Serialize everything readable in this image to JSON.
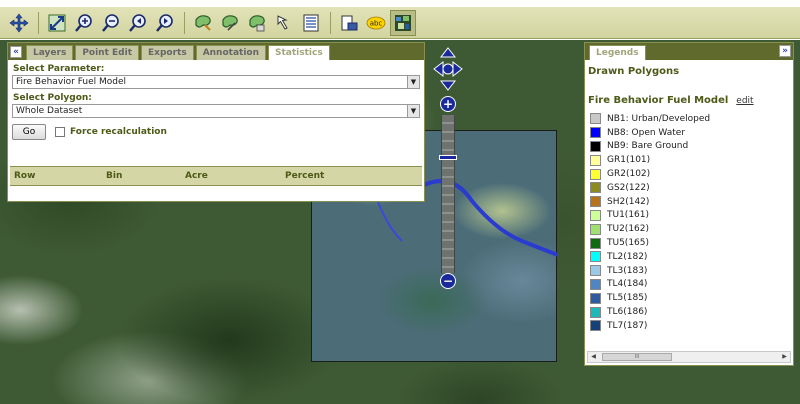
{
  "toolbar": {
    "tools": [
      {
        "icon": "pan-icon"
      },
      {
        "icon": "zoom-extent-icon"
      },
      {
        "icon": "zoom-in-icon"
      },
      {
        "icon": "zoom-out-icon"
      },
      {
        "icon": "previous-extent-icon"
      },
      {
        "icon": "next-extent-icon"
      },
      {
        "icon": "draw-polygon-icon"
      },
      {
        "icon": "edit-polygon-icon"
      },
      {
        "icon": "delete-polygon-icon"
      },
      {
        "icon": "select-arrow-icon"
      },
      {
        "icon": "attribute-table-icon"
      },
      {
        "icon": "print-map-icon"
      },
      {
        "icon": "label-abc-icon"
      },
      {
        "icon": "overlay-layer-icon"
      }
    ],
    "abc_text": "abc"
  },
  "panel": {
    "collapse_glyph": "«",
    "tabs": [
      "Layers",
      "Point Edit",
      "Exports",
      "Annotation",
      "Statistics"
    ],
    "active_tab": "Statistics",
    "parameter_label": "Select Parameter:",
    "parameter_value": "Fire Behavior Fuel Model",
    "polygon_label": "Select Polygon:",
    "polygon_value": "Whole Dataset",
    "go_label": "Go",
    "force_label": "Force recalculation",
    "columns": [
      "Row",
      "Bin",
      "Acre",
      "Percent"
    ]
  },
  "zoom": {
    "plus": "+",
    "minus": "−"
  },
  "legend": {
    "tab": "Legends",
    "expand_glyph": "»",
    "drawn_title": "Drawn Polygons",
    "model_title": "Fire Behavior Fuel Model",
    "edit_label": "edit",
    "items": [
      {
        "label": "NB1: Urban/Developed",
        "color": "#c8c8c8"
      },
      {
        "label": "NB8: Open Water",
        "color": "#0000ff"
      },
      {
        "label": "NB9: Bare Ground",
        "color": "#000000"
      },
      {
        "label": "GR1(101)",
        "color": "#ffff99"
      },
      {
        "label": "GR2(102)",
        "color": "#ffff33"
      },
      {
        "label": "GS2(122)",
        "color": "#8b8b1e"
      },
      {
        "label": "SH2(142)",
        "color": "#b87318"
      },
      {
        "label": "TU1(161)",
        "color": "#ccff99"
      },
      {
        "label": "TU2(162)",
        "color": "#a0e070"
      },
      {
        "label": "TU5(165)",
        "color": "#0f6b0f"
      },
      {
        "label": "TL2(182)",
        "color": "#00ffff"
      },
      {
        "label": "TL3(183)",
        "color": "#9ac8e6"
      },
      {
        "label": "TL4(184)",
        "color": "#4e86c4"
      },
      {
        "label": "TL5(185)",
        "color": "#2d5aa0"
      },
      {
        "label": "TL6(186)",
        "color": "#1fb8b8"
      },
      {
        "label": "TL7(187)",
        "color": "#15407a"
      }
    ],
    "scroll_thumb": "III"
  }
}
